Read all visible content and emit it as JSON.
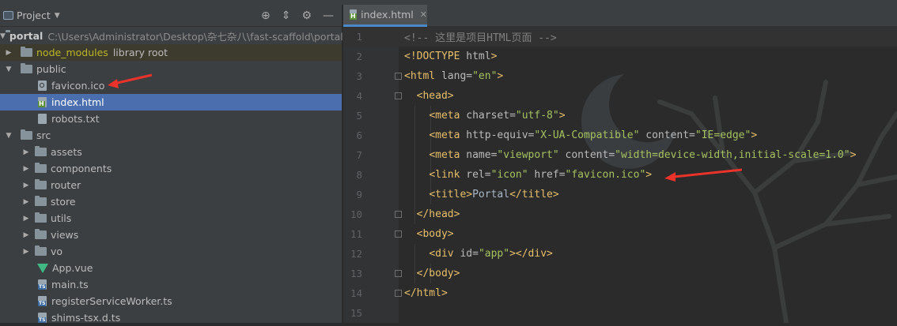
{
  "project_panel": {
    "title": "Project",
    "tree": [
      {
        "label": "portal",
        "path": "C:\\Users\\Administrator\\Desktop\\杂七杂八\\fast-scaffold\\portal"
      },
      {
        "label": "node_modules",
        "suffix": "library root"
      },
      {
        "label": "public"
      },
      {
        "label": "favicon.ico"
      },
      {
        "label": "index.html"
      },
      {
        "label": "robots.txt"
      },
      {
        "label": "src"
      },
      {
        "label": "assets"
      },
      {
        "label": "components"
      },
      {
        "label": "router"
      },
      {
        "label": "store"
      },
      {
        "label": "utils"
      },
      {
        "label": "views"
      },
      {
        "label": "vo"
      },
      {
        "label": "App.vue"
      },
      {
        "label": "main.ts"
      },
      {
        "label": "registerServiceWorker.ts"
      },
      {
        "label": "shims-tsx.d.ts"
      }
    ]
  },
  "editor": {
    "tab_label": "index.html",
    "lines": [
      {
        "n": "1",
        "parts": [
          [
            "t-comment",
            "<!-- 这里是项目HTML页面 -->"
          ]
        ]
      },
      {
        "n": "2",
        "parts": [
          [
            "t-tag",
            "<!DOCTYPE "
          ],
          [
            "t-attr",
            "html"
          ],
          [
            "t-tag",
            ">"
          ]
        ]
      },
      {
        "n": "3",
        "parts": [
          [
            "t-tag",
            "<html "
          ],
          [
            "t-attr",
            "lang="
          ],
          [
            "t-val",
            "\"en\""
          ],
          [
            "t-tag",
            ">"
          ]
        ]
      },
      {
        "n": "4",
        "parts": [
          [
            "t-plain",
            "  "
          ],
          [
            "t-tag",
            "<head>"
          ]
        ]
      },
      {
        "n": "5",
        "parts": [
          [
            "t-plain",
            "    "
          ],
          [
            "t-tag",
            "<meta "
          ],
          [
            "t-attr",
            "charset="
          ],
          [
            "t-val",
            "\"utf-8\""
          ],
          [
            "t-tag",
            ">"
          ]
        ]
      },
      {
        "n": "6",
        "parts": [
          [
            "t-plain",
            "    "
          ],
          [
            "t-tag",
            "<meta "
          ],
          [
            "t-attr",
            "http-equiv="
          ],
          [
            "t-val",
            "\"X-UA-Compatible\""
          ],
          [
            "t-attr",
            " content="
          ],
          [
            "t-val",
            "\"IE=edge\""
          ],
          [
            "t-tag",
            ">"
          ]
        ]
      },
      {
        "n": "7",
        "parts": [
          [
            "t-plain",
            "    "
          ],
          [
            "t-tag",
            "<meta "
          ],
          [
            "t-attr",
            "name="
          ],
          [
            "t-val",
            "\"viewport\""
          ],
          [
            "t-attr",
            " content="
          ],
          [
            "t-val",
            "\"width=device-width,initial-scale=1.0\""
          ],
          [
            "t-tag",
            ">"
          ]
        ]
      },
      {
        "n": "8",
        "parts": [
          [
            "t-plain",
            "    "
          ],
          [
            "t-tag",
            "<link "
          ],
          [
            "t-attr",
            "rel="
          ],
          [
            "t-val",
            "\"icon\""
          ],
          [
            "t-attr",
            " href="
          ],
          [
            "t-val",
            "\"favicon.ico\""
          ],
          [
            "t-tag",
            ">"
          ]
        ]
      },
      {
        "n": "9",
        "parts": [
          [
            "t-plain",
            "    "
          ],
          [
            "t-tag",
            "<title>"
          ],
          [
            "t-plain",
            "Portal"
          ],
          [
            "t-tag",
            "</title>"
          ]
        ]
      },
      {
        "n": "10",
        "parts": [
          [
            "t-plain",
            "  "
          ],
          [
            "t-tag",
            "</head>"
          ]
        ]
      },
      {
        "n": "11",
        "parts": [
          [
            "t-plain",
            "  "
          ],
          [
            "t-tag",
            "<body>"
          ]
        ]
      },
      {
        "n": "12",
        "parts": [
          [
            "t-plain",
            "    "
          ],
          [
            "t-tag",
            "<div "
          ],
          [
            "t-attr",
            "id="
          ],
          [
            "t-val",
            "\"app\""
          ],
          [
            "t-tag",
            "></div>"
          ]
        ]
      },
      {
        "n": "13",
        "parts": [
          [
            "t-plain",
            "  "
          ],
          [
            "t-tag",
            "</body>"
          ]
        ]
      },
      {
        "n": "14",
        "parts": [
          [
            "t-tag",
            "</html>"
          ]
        ]
      },
      {
        "n": "15",
        "parts": []
      }
    ]
  },
  "colors": {
    "accent": "#4b6eaf",
    "arrow": "#e8322a"
  }
}
